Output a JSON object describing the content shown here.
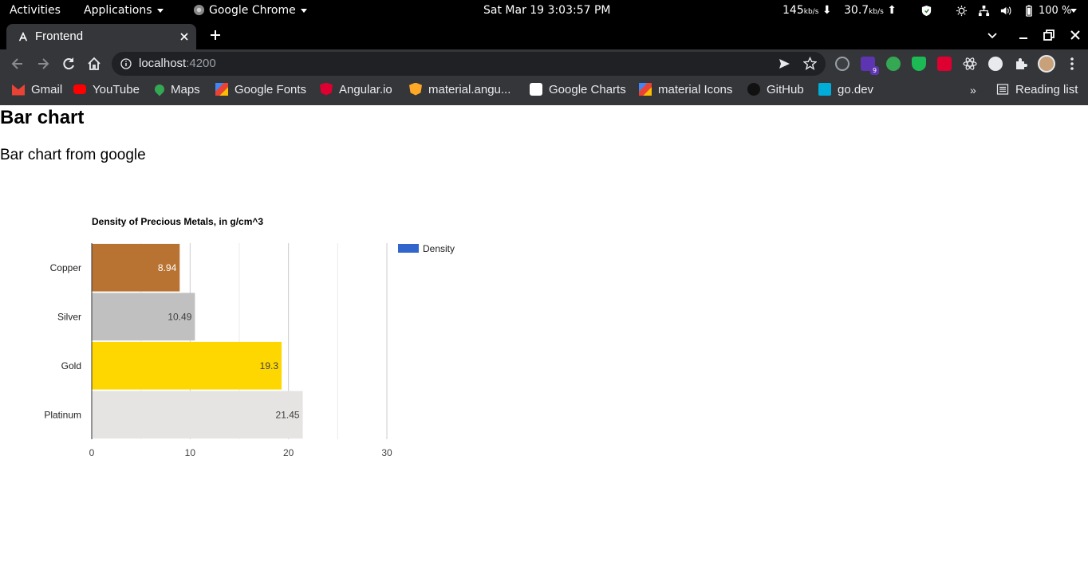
{
  "topbar": {
    "activities": "Activities",
    "applications": "Applications",
    "browser_app": "Google Chrome",
    "datetime": "Sat Mar 19   3:03:57 PM",
    "net_down": "145",
    "net_down_unit": "kb/s",
    "net_up": "30.7",
    "net_up_unit": "kb/s",
    "battery": "100 %"
  },
  "browser": {
    "tab_title": "Frontend",
    "url_host": "localhost",
    "url_port": ":4200",
    "bookmarks": [
      {
        "label": "Gmail",
        "color": "#ea4335"
      },
      {
        "label": "YouTube",
        "color": "#ff0000"
      },
      {
        "label": "Maps",
        "color": "#34a853"
      },
      {
        "label": "Google Fonts",
        "color": "#4285f4"
      },
      {
        "label": "Angular.io",
        "color": "#dd0031"
      },
      {
        "label": "material.angu...",
        "color": "#ffa726"
      },
      {
        "label": "Google Charts",
        "color": "#ffffff"
      },
      {
        "label": "material Icons",
        "color": "#4285f4"
      },
      {
        "label": "GitHub",
        "color": "#111111"
      },
      {
        "label": "go.dev",
        "color": "#00add8"
      }
    ],
    "reading_list": "Reading list",
    "extension_badge": "9"
  },
  "page": {
    "heading": "Bar chart",
    "subheading": "Bar chart from google"
  },
  "chart_data": {
    "type": "bar",
    "orientation": "horizontal",
    "title": "Density of Precious Metals, in g/cm^3",
    "categories": [
      "Copper",
      "Silver",
      "Gold",
      "Platinum"
    ],
    "values": [
      8.94,
      10.49,
      19.3,
      21.45
    ],
    "value_labels": [
      "8.94",
      "10.49",
      "19.3",
      "21.45"
    ],
    "bar_colors": [
      "#b87333",
      "#c0c0c0",
      "#ffd700",
      "#e5e4e2"
    ],
    "series": [
      {
        "name": "Density",
        "values": [
          8.94,
          10.49,
          19.3,
          21.45
        ],
        "color": "#3366cc"
      }
    ],
    "xlim": [
      0,
      30
    ],
    "xticks": [
      "0",
      "10",
      "20",
      "30"
    ],
    "grid": true,
    "legend": "right"
  }
}
